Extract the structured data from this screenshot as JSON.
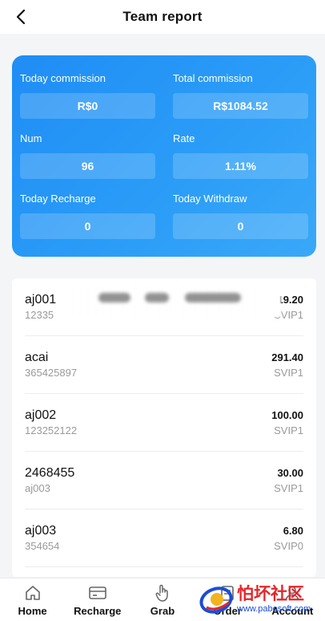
{
  "header": {
    "title": "Team report"
  },
  "stats": [
    {
      "label": "Today commission",
      "value": "R$0"
    },
    {
      "label": "Total commission",
      "value": "R$1084.52"
    },
    {
      "label": "Num",
      "value": "96"
    },
    {
      "label": "Rate",
      "value": "1.11%"
    },
    {
      "label": "Today Recharge",
      "value": "0"
    },
    {
      "label": "Today Withdraw",
      "value": "0"
    }
  ],
  "members": [
    {
      "name": "aj001",
      "id": "12335",
      "amount": "119.20",
      "level": "SVIP1"
    },
    {
      "name": "acai",
      "id": "365425897",
      "amount": "291.40",
      "level": "SVIP1"
    },
    {
      "name": "aj002",
      "id": "123252122",
      "amount": "100.00",
      "level": "SVIP1"
    },
    {
      "name": "2468455",
      "id": "aj003",
      "amount": "30.00",
      "level": "SVIP1"
    },
    {
      "name": "aj003",
      "id": "354654",
      "amount": "6.80",
      "level": "SVIP0"
    }
  ],
  "tabbar": {
    "items": [
      {
        "label": "Home",
        "icon": "home-icon"
      },
      {
        "label": "Recharge",
        "icon": "card-icon"
      },
      {
        "label": "Grab",
        "icon": "hand-pointer-icon"
      },
      {
        "label": "Order",
        "icon": "order-icon"
      },
      {
        "label": "Account",
        "icon": "user-icon"
      }
    ]
  },
  "watermark": {
    "text": "怕坏社区",
    "url": "www.pabosoft.com"
  },
  "colors": {
    "card_start": "#1f8df5",
    "card_end": "#3aa8f8",
    "watermark_red": "#e4262b"
  }
}
